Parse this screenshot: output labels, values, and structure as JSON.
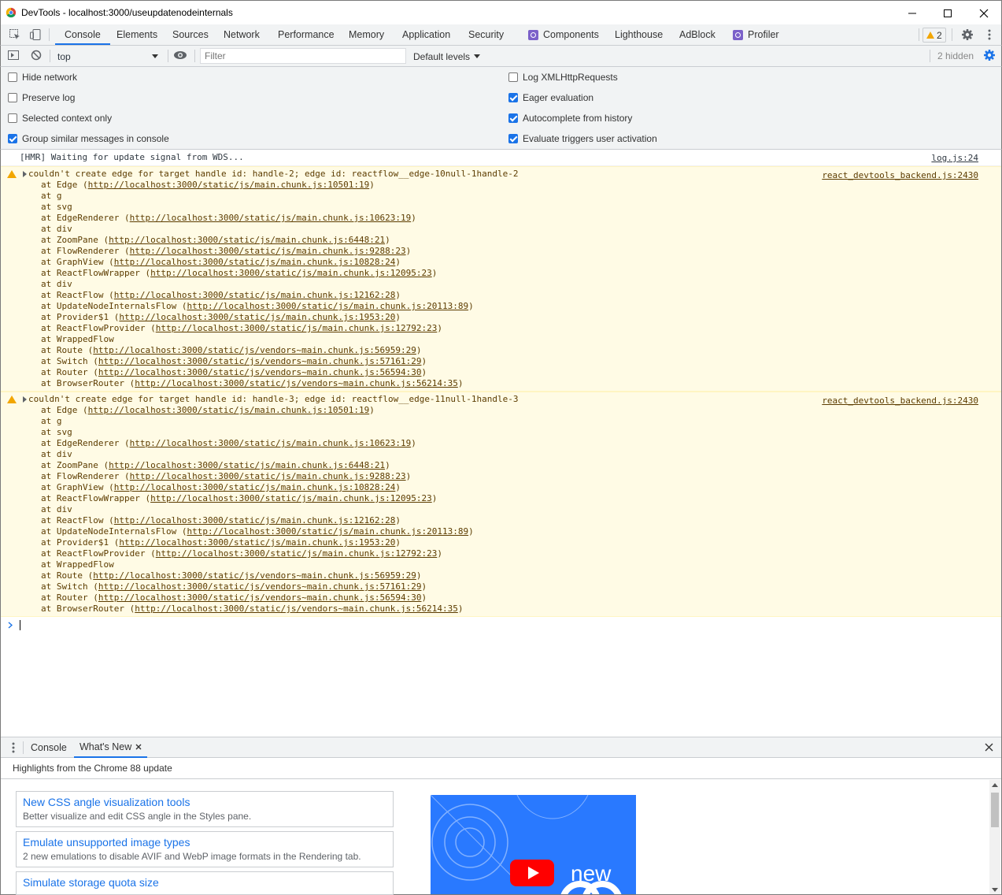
{
  "window": {
    "title": "DevTools - localhost:3000/useupdatenodeinternals"
  },
  "tabs": [
    "Console",
    "Elements",
    "Sources",
    "Network",
    "Performance",
    "Memory",
    "Application",
    "Security",
    "Components",
    "Lighthouse",
    "AdBlock",
    "Profiler"
  ],
  "warnings_badge": "2",
  "toolbar": {
    "context": "top",
    "filter_placeholder": "Filter",
    "levels": "Default levels",
    "hidden": "2 hidden"
  },
  "settings": {
    "left": [
      {
        "label": "Hide network",
        "checked": false
      },
      {
        "label": "Preserve log",
        "checked": false
      },
      {
        "label": "Selected context only",
        "checked": false
      },
      {
        "label": "Group similar messages in console",
        "checked": true
      }
    ],
    "right": [
      {
        "label": "Log XMLHttpRequests",
        "checked": false
      },
      {
        "label": "Eager evaluation",
        "checked": true
      },
      {
        "label": "Autocomplete from history",
        "checked": true
      },
      {
        "label": "Evaluate triggers user activation",
        "checked": true
      }
    ]
  },
  "console": {
    "info": {
      "text": "[HMR] Waiting for update signal from WDS...",
      "source": "log.js:24"
    },
    "warnings": [
      {
        "text": "couldn't create edge for target handle id: handle-2; edge id: reactflow__edge-10null-1handle-2",
        "source": "react_devtools_backend.js:2430",
        "frames": [
          {
            "fn": "Edge",
            "url": "http://localhost:3000/static/js/main.chunk.js:10501:19"
          },
          {
            "fn": "g",
            "url": ""
          },
          {
            "fn": "svg",
            "url": ""
          },
          {
            "fn": "EdgeRenderer",
            "url": "http://localhost:3000/static/js/main.chunk.js:10623:19"
          },
          {
            "fn": "div",
            "url": ""
          },
          {
            "fn": "ZoomPane",
            "url": "http://localhost:3000/static/js/main.chunk.js:6448:21"
          },
          {
            "fn": "FlowRenderer",
            "url": "http://localhost:3000/static/js/main.chunk.js:9288:23"
          },
          {
            "fn": "GraphView",
            "url": "http://localhost:3000/static/js/main.chunk.js:10828:24"
          },
          {
            "fn": "ReactFlowWrapper",
            "url": "http://localhost:3000/static/js/main.chunk.js:12095:23"
          },
          {
            "fn": "div",
            "url": ""
          },
          {
            "fn": "ReactFlow",
            "url": "http://localhost:3000/static/js/main.chunk.js:12162:28"
          },
          {
            "fn": "UpdateNodeInternalsFlow",
            "url": "http://localhost:3000/static/js/main.chunk.js:20113:89"
          },
          {
            "fn": "Provider$1",
            "url": "http://localhost:3000/static/js/main.chunk.js:1953:20"
          },
          {
            "fn": "ReactFlowProvider",
            "url": "http://localhost:3000/static/js/main.chunk.js:12792:23"
          },
          {
            "fn": "WrappedFlow",
            "url": ""
          },
          {
            "fn": "Route",
            "url": "http://localhost:3000/static/js/vendors~main.chunk.js:56959:29"
          },
          {
            "fn": "Switch",
            "url": "http://localhost:3000/static/js/vendors~main.chunk.js:57161:29"
          },
          {
            "fn": "Router",
            "url": "http://localhost:3000/static/js/vendors~main.chunk.js:56594:30"
          },
          {
            "fn": "BrowserRouter",
            "url": "http://localhost:3000/static/js/vendors~main.chunk.js:56214:35"
          }
        ]
      },
      {
        "text": "couldn't create edge for target handle id: handle-3; edge id: reactflow__edge-11null-1handle-3",
        "source": "react_devtools_backend.js:2430",
        "frames": [
          {
            "fn": "Edge",
            "url": "http://localhost:3000/static/js/main.chunk.js:10501:19"
          },
          {
            "fn": "g",
            "url": ""
          },
          {
            "fn": "svg",
            "url": ""
          },
          {
            "fn": "EdgeRenderer",
            "url": "http://localhost:3000/static/js/main.chunk.js:10623:19"
          },
          {
            "fn": "div",
            "url": ""
          },
          {
            "fn": "ZoomPane",
            "url": "http://localhost:3000/static/js/main.chunk.js:6448:21"
          },
          {
            "fn": "FlowRenderer",
            "url": "http://localhost:3000/static/js/main.chunk.js:9288:23"
          },
          {
            "fn": "GraphView",
            "url": "http://localhost:3000/static/js/main.chunk.js:10828:24"
          },
          {
            "fn": "ReactFlowWrapper",
            "url": "http://localhost:3000/static/js/main.chunk.js:12095:23"
          },
          {
            "fn": "div",
            "url": ""
          },
          {
            "fn": "ReactFlow",
            "url": "http://localhost:3000/static/js/main.chunk.js:12162:28"
          },
          {
            "fn": "UpdateNodeInternalsFlow",
            "url": "http://localhost:3000/static/js/main.chunk.js:20113:89"
          },
          {
            "fn": "Provider$1",
            "url": "http://localhost:3000/static/js/main.chunk.js:1953:20"
          },
          {
            "fn": "ReactFlowProvider",
            "url": "http://localhost:3000/static/js/main.chunk.js:12792:23"
          },
          {
            "fn": "WrappedFlow",
            "url": ""
          },
          {
            "fn": "Route",
            "url": "http://localhost:3000/static/js/vendors~main.chunk.js:56959:29"
          },
          {
            "fn": "Switch",
            "url": "http://localhost:3000/static/js/vendors~main.chunk.js:57161:29"
          },
          {
            "fn": "Router",
            "url": "http://localhost:3000/static/js/vendors~main.chunk.js:56594:30"
          },
          {
            "fn": "BrowserRouter",
            "url": "http://localhost:3000/static/js/vendors~main.chunk.js:56214:35"
          }
        ]
      }
    ]
  },
  "drawer": {
    "tabs": [
      "Console",
      "What's New"
    ],
    "highlights": "Highlights from the Chrome 88 update",
    "cards": [
      {
        "title": "New CSS angle visualization tools",
        "desc": "Better visualize and edit CSS angle in the Styles pane."
      },
      {
        "title": "Emulate unsupported image types",
        "desc": "2 new emulations to disable AVIF and WebP image formats in the Rendering tab."
      },
      {
        "title": "Simulate storage quota size",
        "desc": ""
      }
    ],
    "video_label": "new"
  },
  "colors": {
    "accent": "#1a73e8",
    "warning_bg": "#fffbe5",
    "warning_icon": "#f2a600",
    "video_bg": "#2979ff",
    "play_red": "#ff0000"
  }
}
